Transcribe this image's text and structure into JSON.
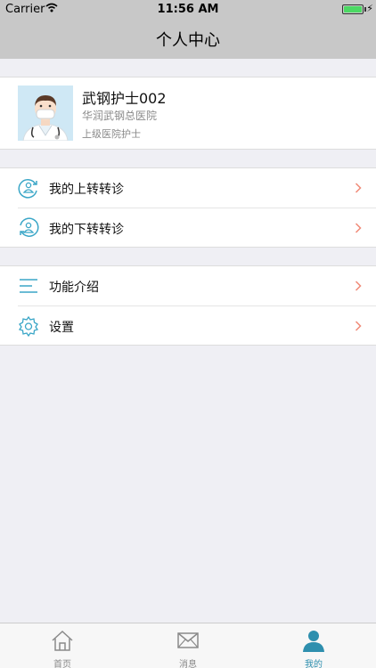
{
  "status_bar": {
    "carrier": "Carrier",
    "time": "11:56 AM"
  },
  "nav": {
    "title": "个人中心"
  },
  "profile": {
    "name": "武钢护士002",
    "hospital": "华润武钢总医院",
    "role": "上级医院护士"
  },
  "menu_groups": [
    {
      "items": [
        {
          "label": "我的上转转诊",
          "icon": "referral-up-icon"
        },
        {
          "label": "我的下转转诊",
          "icon": "referral-down-icon"
        }
      ]
    },
    {
      "items": [
        {
          "label": "功能介绍",
          "icon": "list-icon"
        },
        {
          "label": "设置",
          "icon": "gear-icon"
        }
      ]
    }
  ],
  "tabs": [
    {
      "label": "首页",
      "icon": "home-icon",
      "active": false
    },
    {
      "label": "消息",
      "icon": "mail-icon",
      "active": false
    },
    {
      "label": "我的",
      "icon": "person-icon",
      "active": true
    }
  ],
  "colors": {
    "accent": "#3aa6c7",
    "chevron": "#f08a78",
    "active_tab": "#2e8fae"
  }
}
